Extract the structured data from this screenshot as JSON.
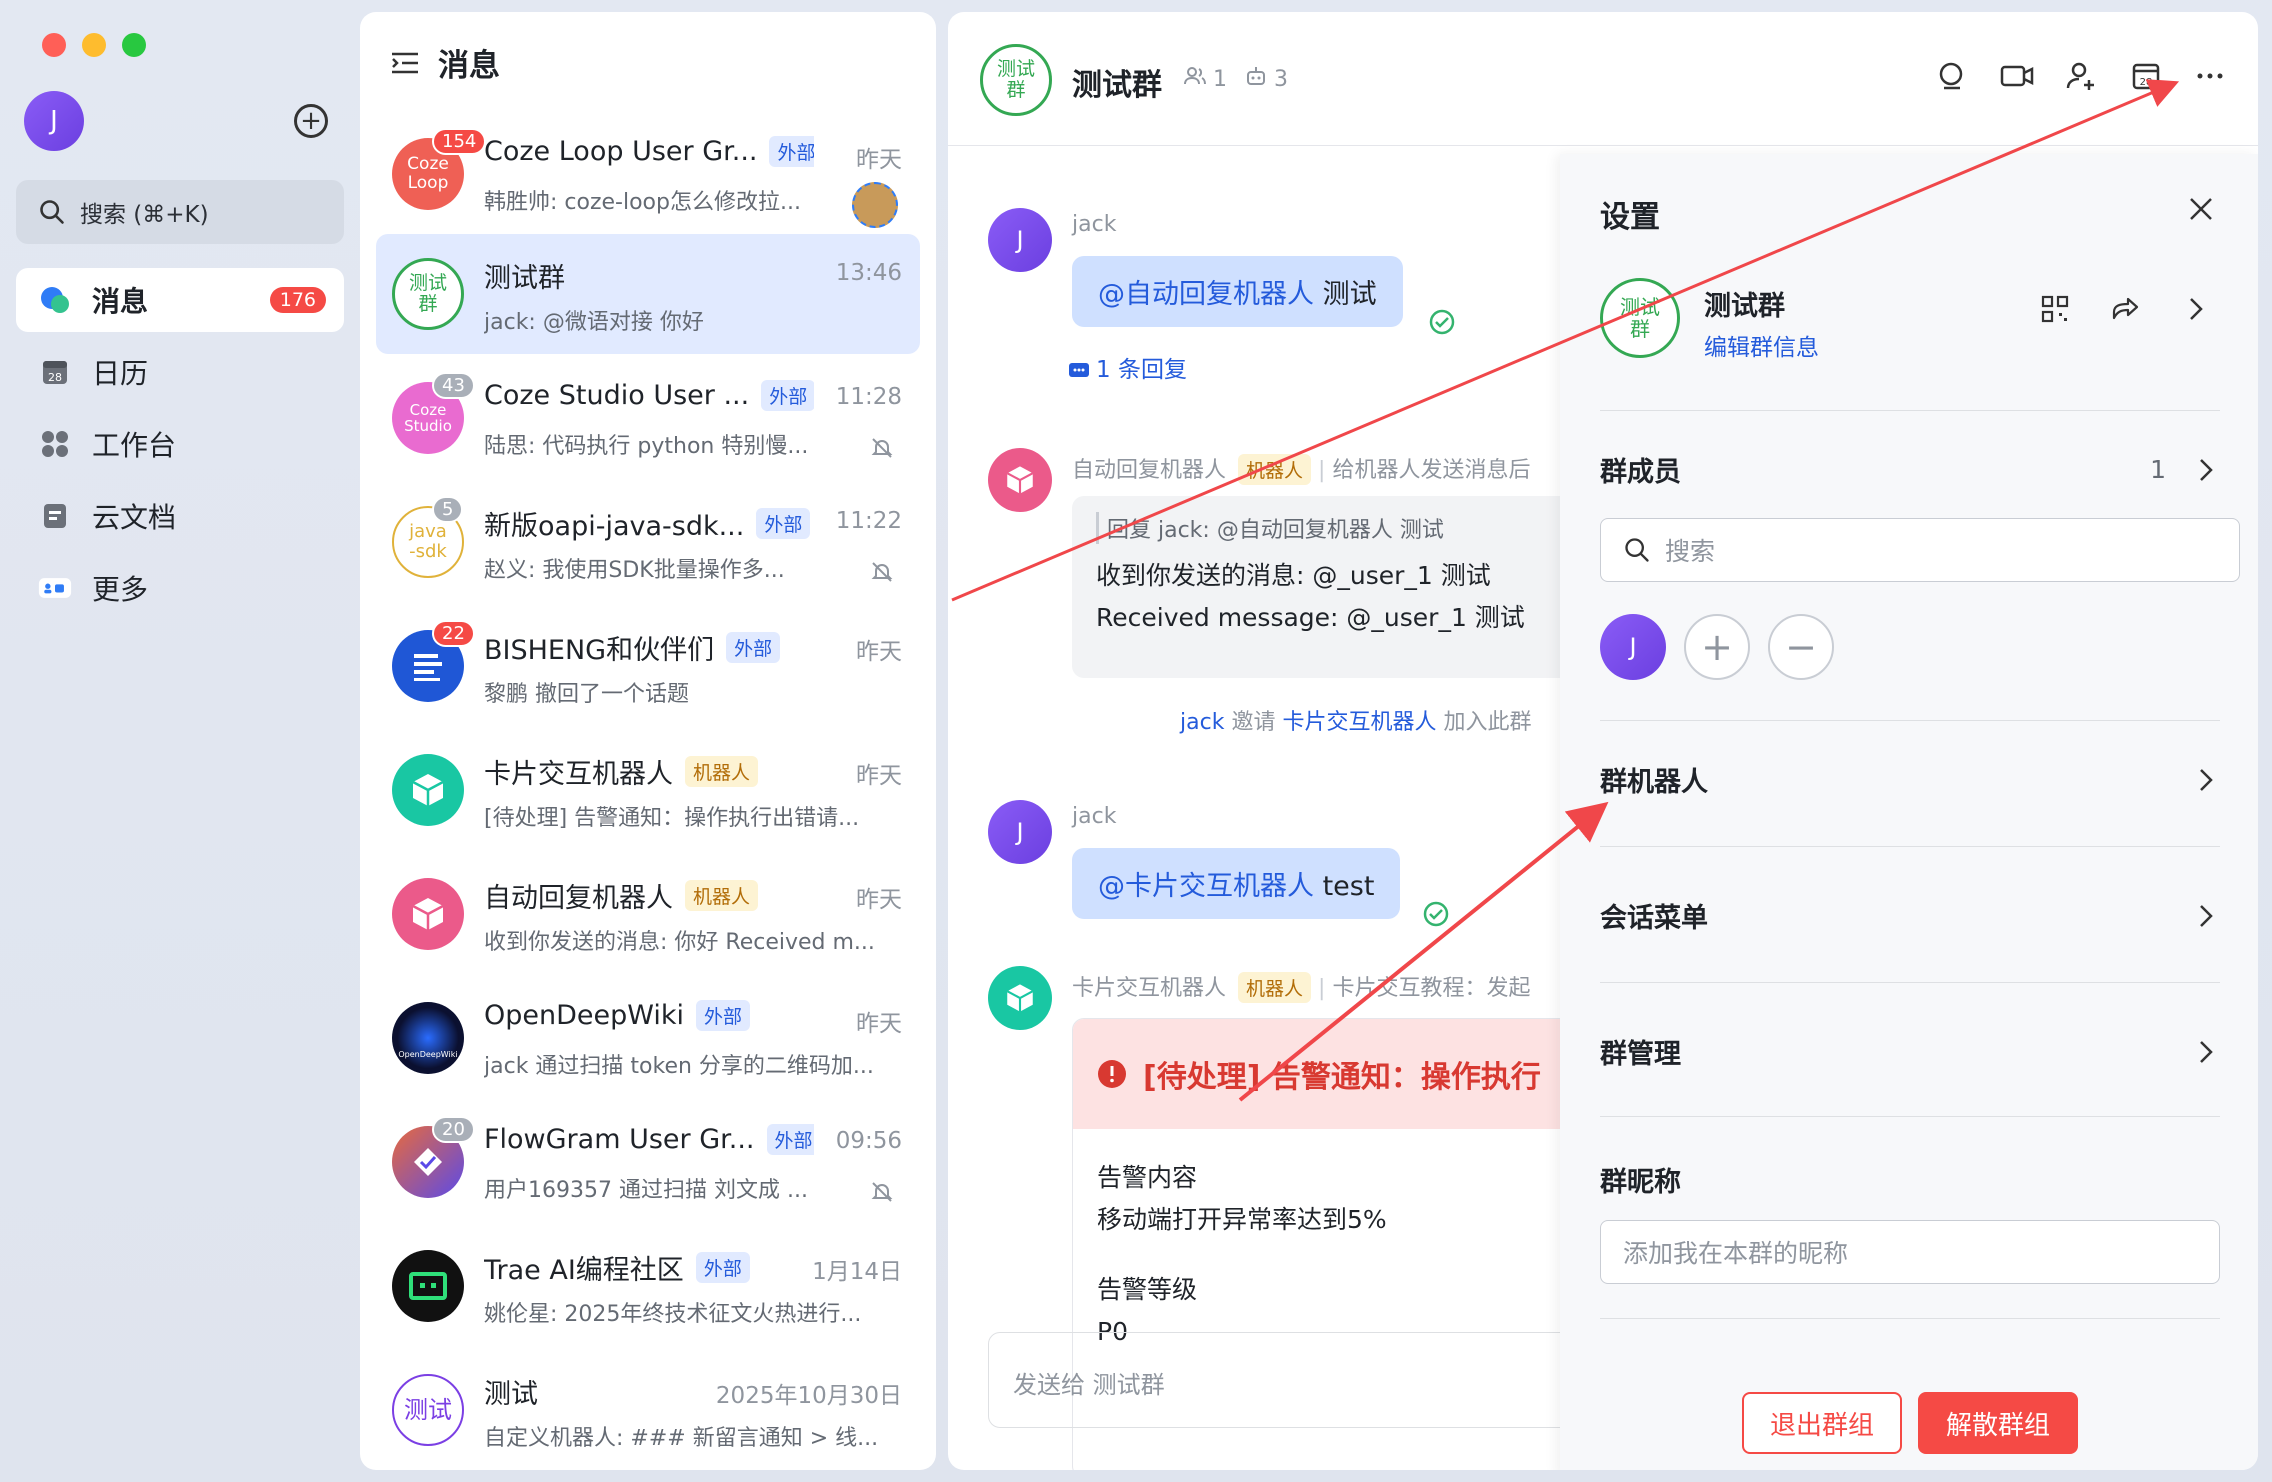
{
  "nav": {
    "avatar_letter": "J",
    "search_label": "搜索 (⌘+K)",
    "items": [
      {
        "label": "消息",
        "badge": "176"
      },
      {
        "label": "日历"
      },
      {
        "label": "工作台"
      },
      {
        "label": "云文档"
      },
      {
        "label": "更多"
      }
    ],
    "calendar_day": "28"
  },
  "list": {
    "title": "消息",
    "conversations": [
      {
        "name": "Coze Loop User Gr...",
        "tag": "外部",
        "time": "昨天",
        "sub": "韩胜帅: coze-loop怎么修改拉...",
        "count": "154",
        "avatar_text": "Coze Loop"
      },
      {
        "name": "测试群",
        "tag": "",
        "time": "13:46",
        "sub": "jack: @微语对接 你好",
        "avatar_text": "测试群"
      },
      {
        "name": "Coze Studio User ...",
        "tag": "外部",
        "time": "11:28",
        "sub": "陆思: 代码执行 python 特别慢...",
        "count": "43",
        "avatar_text": "Coze Studio"
      },
      {
        "name": "新版oapi-java-sdk...",
        "tag": "外部",
        "time": "11:22",
        "sub": "赵义: 我使用SDK批量操作多...",
        "count": "5",
        "avatar_text": "java -sdk"
      },
      {
        "name": "BISHENG和伙伴们",
        "tag": "外部",
        "time": "昨天",
        "sub": "黎鹏 撤回了一个话题",
        "count": "22",
        "avatar_text": ""
      },
      {
        "name": "卡片交互机器人",
        "tag": "机器人",
        "time": "昨天",
        "sub": "[待处理] 告警通知：操作执行出错请...",
        "avatar_text": ""
      },
      {
        "name": "自动回复机器人",
        "tag": "机器人",
        "time": "昨天",
        "sub": "收到你发送的消息: 你好 Received m...",
        "avatar_text": ""
      },
      {
        "name": "OpenDeepWiki",
        "tag": "外部",
        "time": "昨天",
        "sub": "jack 通过扫描 token 分享的二维码加...",
        "avatar_text": "OpenDeepWiki"
      },
      {
        "name": "FlowGram User Gr...",
        "tag": "外部",
        "time": "09:56",
        "sub": "用户169357 通过扫描 刘文成 ...",
        "count": "20",
        "avatar_text": ""
      },
      {
        "name": "Trae AI编程社区",
        "tag": "外部",
        "time": "1月14日",
        "sub": "姚伦星: 2025年终技术征文火热进行...",
        "avatar_text": ""
      },
      {
        "name": "测试",
        "tag": "",
        "time": "2025年10月30日",
        "sub": "自定义机器人: ### 新留言通知 > 线...",
        "avatar_text": "测试"
      }
    ]
  },
  "chat": {
    "title": "测试群",
    "avatar_text": "测试群",
    "member_count": "1",
    "bot_count": "3",
    "messages": {
      "m1_name": "jack",
      "m1_at": "@自动回复机器人",
      "m1_text": "测试",
      "m1_reply": "1 条回复",
      "m2_name": "自动回复机器人",
      "m2_tag": "机器人",
      "m2_desc": "给机器人发送消息后",
      "m2_quote": "回复 jack: @自动回复机器人 测试",
      "m2_line1": "收到你发送的消息: @_user_1 测试",
      "m2_line2": "Received message: @_user_1 测试",
      "sys_actor": "jack",
      "sys_verb": "邀请",
      "sys_target": "卡片交互机器人",
      "sys_tail": "加入此群",
      "m3_name": "jack",
      "m3_at": "@卡片交互机器人",
      "m3_text": "test",
      "m4_name": "卡片交互机器人",
      "m4_tag": "机器人",
      "m4_desc": "卡片交互教程：发起",
      "alert_title": "[待处理] 告警通知：操作执行",
      "alert_k1": "告警内容",
      "alert_v1": "移动端打开异常率达到5%",
      "alert_k2": "告警等级",
      "alert_v2": "P0"
    },
    "input_placeholder": "发送给 测试群"
  },
  "settings": {
    "title": "设置",
    "group_name": "测试群",
    "group_avatar_text": "测试群",
    "edit_info": "编辑群信息",
    "members_label": "群成员",
    "members_count": "1",
    "search_placeholder": "搜索",
    "member_avatar": "J",
    "bots_label": "群机器人",
    "menu_label": "会话菜单",
    "manage_label": "群管理",
    "nickname_label": "群昵称",
    "nickname_placeholder": "添加我在本群的昵称",
    "exit_label": "退出群组",
    "dissolve_label": "解散群组"
  },
  "colors": {
    "accent": "#245bdb",
    "danger": "#f54a45",
    "group_green": "#34a853",
    "annotation_arrow": "#f0474a"
  }
}
